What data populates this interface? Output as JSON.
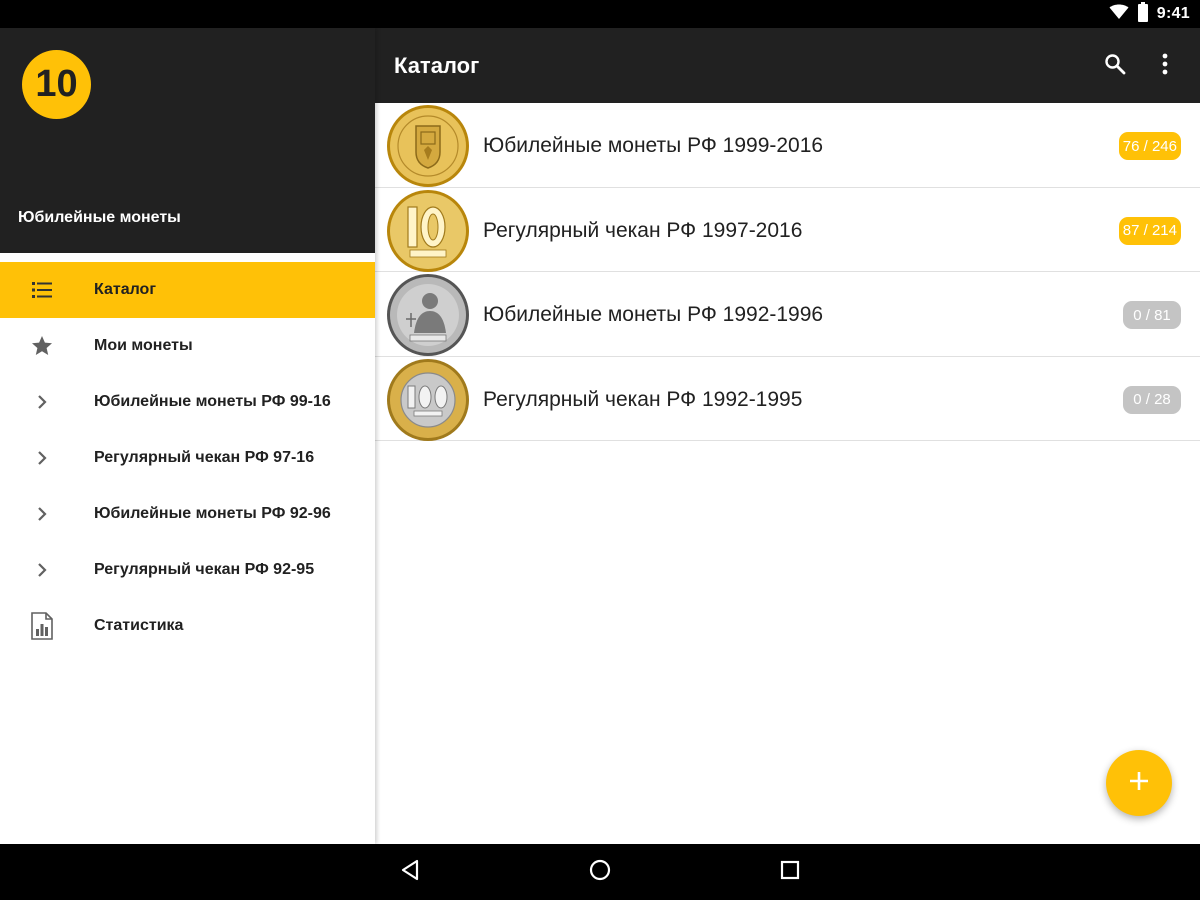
{
  "status_bar": {
    "time": "9:41"
  },
  "drawer": {
    "logo_text": "10",
    "subtitle": "Юбилейные монеты",
    "items": [
      {
        "label": "Каталог",
        "icon": "list-icon",
        "active": true
      },
      {
        "label": "Мои монеты",
        "icon": "star-icon",
        "active": false
      },
      {
        "label": "Юбилейные монеты РФ 99-16",
        "icon": "chevron-right-icon",
        "active": false
      },
      {
        "label": "Регулярный чекан РФ 97-16",
        "icon": "chevron-right-icon",
        "active": false
      },
      {
        "label": "Юбилейные монеты РФ 92-96",
        "icon": "chevron-right-icon",
        "active": false
      },
      {
        "label": "Регулярный чекан РФ 92-95",
        "icon": "chevron-right-icon",
        "active": false
      },
      {
        "label": "Статистика",
        "icon": "chart-document-icon",
        "active": false
      }
    ]
  },
  "toolbar": {
    "title": "Каталог"
  },
  "catalog": [
    {
      "title": "Юбилейные монеты РФ 1999-2016",
      "count": "76 / 246",
      "badge_color": "#ffc107",
      "coin_type": "gold-coat-of-arms"
    },
    {
      "title": "Регулярный чекан РФ 1997-2016",
      "count": "87 / 214",
      "badge_color": "#ffc107",
      "coin_type": "gold-10"
    },
    {
      "title": "Юбилейные монеты РФ 1992-1996",
      "count": "0 / 81",
      "badge_color": "#c4c4c4",
      "coin_type": "silver-portrait"
    },
    {
      "title": "Регулярный чекан РФ 1992-1995",
      "count": "0 / 28",
      "badge_color": "#c4c4c4",
      "coin_type": "bimetal-100"
    }
  ],
  "colors": {
    "accent": "#ffc107",
    "toolbar": "#212121",
    "inactive_badge": "#c4c4c4"
  }
}
